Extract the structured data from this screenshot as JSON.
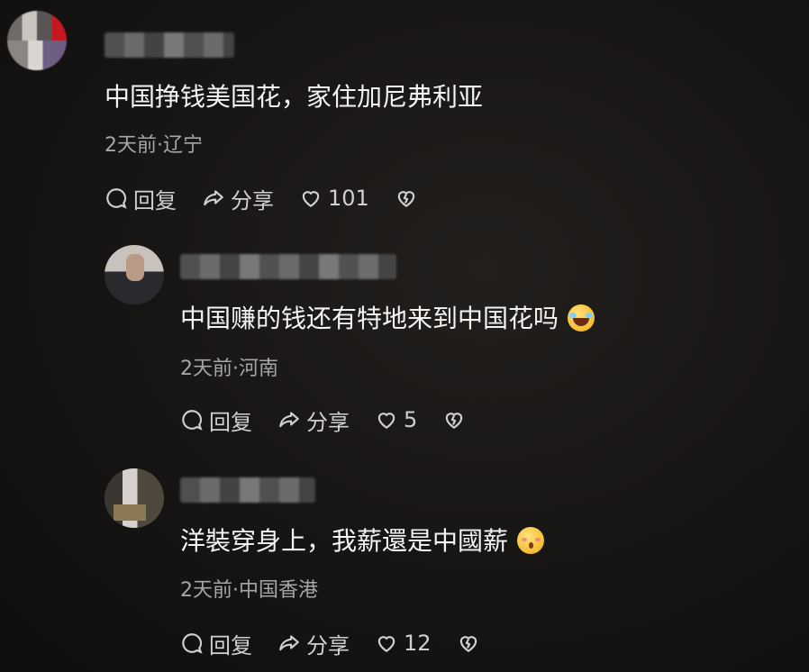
{
  "comments": [
    {
      "text": "中国挣钱美国花，家住加尼弗利亚",
      "meta": "2天前·辽宁",
      "reply_label": "回复",
      "share_label": "分享",
      "likes": "101"
    },
    {
      "text": "中国赚的钱还有特地来到中国花吗",
      "emoji": "face-with-tears-of-joy",
      "meta": "2天前·河南",
      "reply_label": "回复",
      "share_label": "分享",
      "likes": "5"
    },
    {
      "text": "洋裝穿身上，我薪還是中國薪",
      "emoji": "kissing-face-with-closed-eyes",
      "meta": "2天前·中国香港",
      "reply_label": "回复",
      "share_label": "分享",
      "likes": "12"
    }
  ],
  "icons": {
    "reply": "comment-bubble-icon",
    "share": "share-arrow-icon",
    "like": "heart-icon",
    "dislike": "broken-heart-icon"
  }
}
